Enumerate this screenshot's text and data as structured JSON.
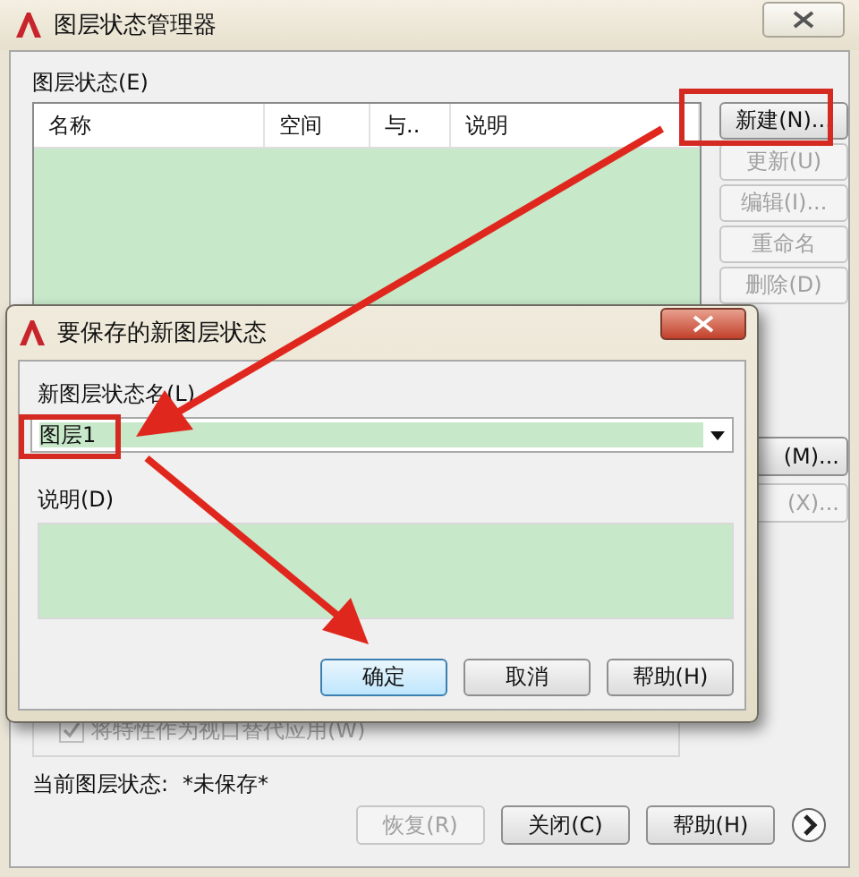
{
  "main_window": {
    "title": "图层状态管理器",
    "list_label": "图层状态(E)",
    "columns": [
      "名称",
      "空间",
      "与..",
      "说明"
    ],
    "side_buttons": [
      {
        "label": "新建(N)...",
        "disabled": false
      },
      {
        "label": "更新(U)",
        "disabled": true
      },
      {
        "label": "编辑(I)...",
        "disabled": true
      },
      {
        "label": "重命名",
        "disabled": true
      },
      {
        "label": "删除(D)",
        "disabled": true
      }
    ],
    "partial_buttons": [
      {
        "label": "(M)...",
        "disabled": false
      },
      {
        "label": "(X)...",
        "disabled": true
      }
    ],
    "option": {
      "label": "将特性作为视口替代应用(W)",
      "checked": true,
      "disabled": true
    },
    "current_state_label": "当前图层状态:",
    "current_state": "*未保存*",
    "bottom_buttons": [
      {
        "label": "恢复(R)",
        "disabled": true
      },
      {
        "label": "关闭(C)",
        "disabled": false
      },
      {
        "label": "帮助(H)",
        "disabled": false
      }
    ]
  },
  "dialog": {
    "title": "要保存的新图层状态",
    "name_label": "新图层状态名(L)",
    "name_value": "图层1",
    "description_label": "说明(D)",
    "buttons": [
      {
        "label": "确定",
        "default": true
      },
      {
        "label": "取消",
        "default": false
      },
      {
        "label": "帮助(H)",
        "default": false
      }
    ]
  }
}
